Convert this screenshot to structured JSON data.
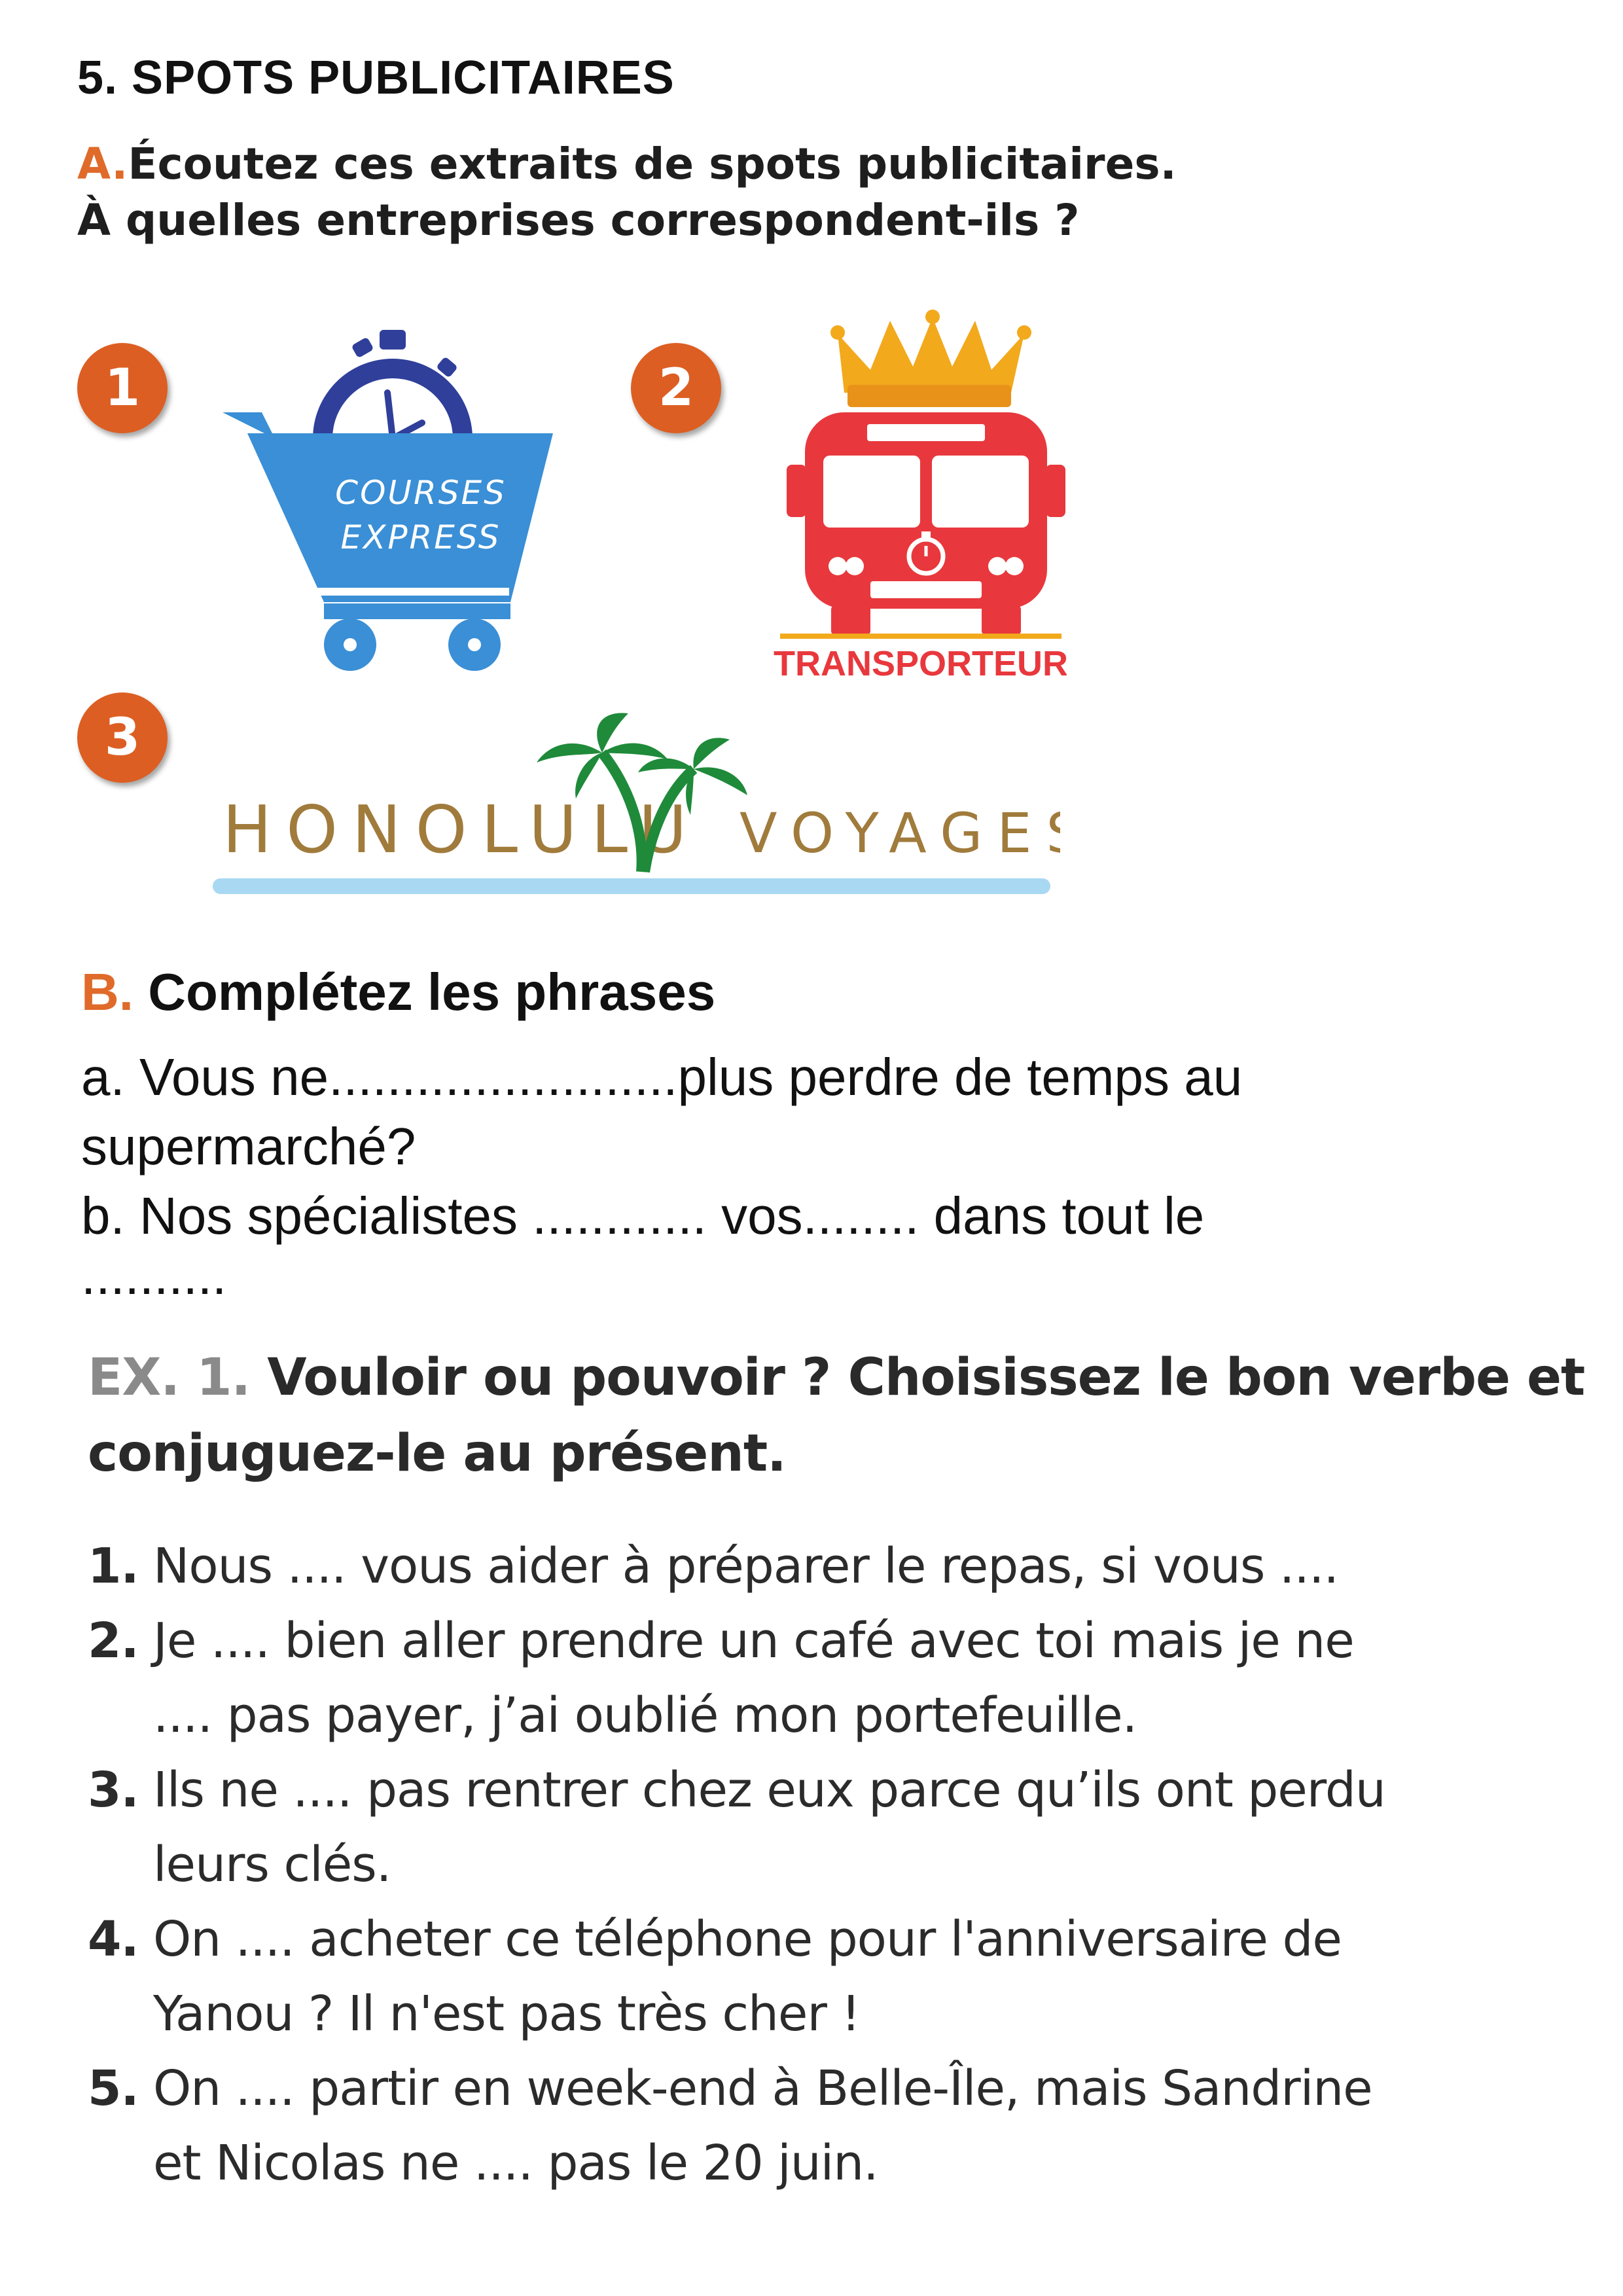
{
  "header": {
    "title": "5. SPOTS PUBLICITAIRES"
  },
  "section_a": {
    "letter": "A.",
    "line1": "Écoutez ces extraits de spots publicitaires.",
    "line2": "À quelles entreprises correspondent-ils ?"
  },
  "logos": [
    {
      "badge": "1",
      "lines": [
        "COURSES",
        "EXPRESS"
      ],
      "color": "#3a8fd6"
    },
    {
      "badge": "2",
      "name": "TRANSPORTEUR",
      "color": "#e8383d",
      "crown_color": "#f2a91c"
    },
    {
      "badge": "3",
      "word1": "HONOLULU",
      "word2": "VOYAGES",
      "text_color": "#a07b3c",
      "palm_color": "#1f8a3a",
      "line_color": "#a9d8f2"
    }
  ],
  "section_b": {
    "letter": "B.",
    "title": "Complétez les phrases",
    "sentences": [
      "a. Vous ne........................plus perdre de temps au",
      "supermarché?",
      "b. Nos spécialistes ............ vos........ dans tout le",
      ".........."
    ]
  },
  "exercise": {
    "label": "EX. 1.",
    "title_line1": "Vouloir ou pouvoir ? Choisissez le bon verbe et",
    "title_line2": "conjuguez-le au présent.",
    "items": [
      {
        "num": "1.",
        "lines": [
          "Nous .... vous aider à préparer le repas, si vous ...."
        ]
      },
      {
        "num": "2.",
        "lines": [
          "Je .... bien aller prendre un café avec toi mais je ne",
          ".... pas payer, j’ai oublié mon portefeuille."
        ]
      },
      {
        "num": "3.",
        "lines": [
          "Ils ne .... pas rentrer chez eux parce qu’ils ont perdu",
          "leurs clés."
        ]
      },
      {
        "num": "4.",
        "lines": [
          "On .... acheter ce téléphone pour l'anniversaire de",
          "Yanou ? Il n'est pas très cher !"
        ]
      },
      {
        "num": "5.",
        "lines": [
          "On .... partir en week-end à Belle-Île, mais Sandrine",
          "et Nicolas ne .... pas le 20 juin."
        ]
      }
    ]
  }
}
